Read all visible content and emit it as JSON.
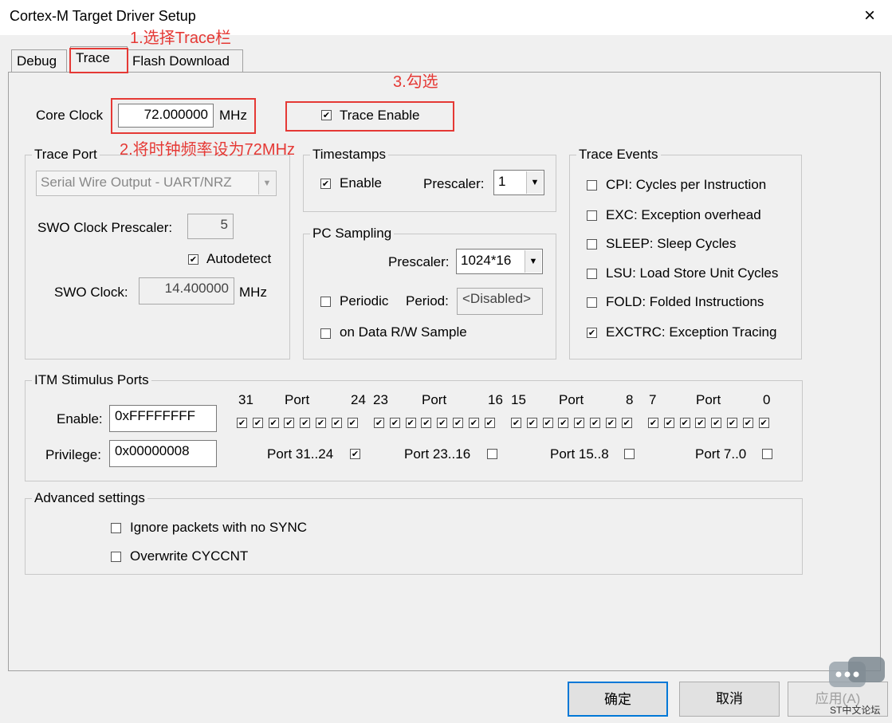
{
  "window": {
    "title": "Cortex-M Target Driver Setup",
    "close": "×"
  },
  "tabs": [
    {
      "label": "Debug"
    },
    {
      "label": "Trace"
    },
    {
      "label": "Flash Download"
    }
  ],
  "core_clock": {
    "label": "Core Clock",
    "value": "72.000000",
    "unit": "MHz"
  },
  "trace_enable": {
    "label": "Trace Enable",
    "checked": true
  },
  "trace_port": {
    "title": "Trace Port",
    "select": "Serial Wire Output - UART/NRZ",
    "swo_prescaler_label": "SWO Clock Prescaler:",
    "swo_prescaler_value": "5",
    "autodetect_label": "Autodetect",
    "swo_clock_label": "SWO Clock:",
    "swo_clock_value": "14.400000",
    "swo_clock_unit": "MHz"
  },
  "timestamps": {
    "title": "Timestamps",
    "enable_label": "Enable",
    "prescaler_label": "Prescaler:",
    "prescaler_value": "1"
  },
  "pc_sampling": {
    "title": "PC Sampling",
    "prescaler_label": "Prescaler:",
    "prescaler_value": "1024*16",
    "periodic_label": "Periodic",
    "period_label": "Period:",
    "period_value": "<Disabled>",
    "data_rw_label": "on Data R/W Sample"
  },
  "trace_events": {
    "title": "Trace Events",
    "items": [
      {
        "label": "CPI: Cycles per Instruction",
        "checked": false
      },
      {
        "label": "EXC: Exception overhead",
        "checked": false
      },
      {
        "label": "SLEEP: Sleep Cycles",
        "checked": false
      },
      {
        "label": "LSU: Load Store Unit Cycles",
        "checked": false
      },
      {
        "label": "FOLD: Folded Instructions",
        "checked": false
      },
      {
        "label": "EXCTRC: Exception Tracing",
        "checked": true
      }
    ]
  },
  "itm": {
    "title": "ITM Stimulus Ports",
    "enable_label": "Enable:",
    "enable_value": "0xFFFFFFFF",
    "privilege_label": "Privilege:",
    "privilege_value": "0x00000008",
    "headers": [
      "31",
      "Port",
      "24",
      "23",
      "Port",
      "16",
      "15",
      "Port",
      "8",
      "7",
      "Port",
      "0"
    ],
    "privilege_groups": [
      {
        "label": "Port 31..24",
        "checked": true
      },
      {
        "label": "Port 23..16",
        "checked": false
      },
      {
        "label": "Port 15..8",
        "checked": false
      },
      {
        "label": "Port 7..0",
        "checked": false
      }
    ]
  },
  "advanced": {
    "title": "Advanced settings",
    "ignore_sync_label": "Ignore packets with no SYNC",
    "overwrite_label": "Overwrite CYCCNT"
  },
  "annotations": {
    "step1": "1.选择Trace栏",
    "step2": "2.将时钟频率设为72MHz",
    "step3": "3.勾选"
  },
  "buttons": {
    "ok": "确定",
    "cancel": "取消",
    "apply": "应用(A)"
  },
  "watermark": "ST中文论坛",
  "colors": {
    "annotation": "#e53935",
    "dialog_bg": "#f0f0f0",
    "default_button_border": "#0078d7"
  }
}
